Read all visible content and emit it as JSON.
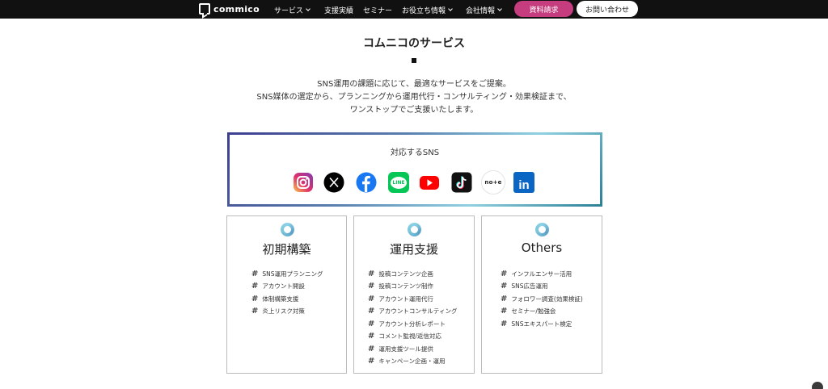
{
  "header": {
    "logo_text": "commico",
    "nav": [
      {
        "label": "サービス",
        "dropdown": true
      },
      {
        "label": "支援実績",
        "dropdown": false
      },
      {
        "label": "セミナー",
        "dropdown": false
      },
      {
        "label": "お役立ち情報",
        "dropdown": true
      },
      {
        "label": "会社情報",
        "dropdown": true
      }
    ],
    "request_button": "資料請求",
    "contact_button": "お問い合わせ"
  },
  "section": {
    "title": "コムニコのサービス",
    "description": [
      "SNS運用の課題に応じて、最適なサービスをご提案。",
      "SNS媒体の選定から、プランニングから運用代行・コンサルティング・効果検証まで、",
      "ワンストップでご支援いたします。"
    ]
  },
  "sns": {
    "title": "対応するSNS",
    "icons": [
      "instagram-icon",
      "x-icon",
      "facebook-icon",
      "line-icon",
      "youtube-icon",
      "tiktok-icon",
      "note-icon",
      "linkedin-icon"
    ],
    "line_text": "LINE",
    "note_text": "no+e",
    "linkedin_text": "in"
  },
  "services": [
    {
      "title": "初期構築",
      "items": [
        "SNS運用プランニング",
        "アカウント開設",
        "体制構築支援",
        "炎上リスク対策"
      ]
    },
    {
      "title": "運用支援",
      "items": [
        "投稿コンテンツ企画",
        "投稿コンテンツ制作",
        "アカウント運用代行",
        "アカウントコンサルティング",
        "アカウント分析レポート",
        "コメント監視/返信対応",
        "運用支援ツール提供",
        "キャンペーン企画・運用"
      ]
    },
    {
      "title": "Others",
      "items": [
        "インフルエンサー活用",
        "SNS広告運用",
        "フォロワー調査(効果検証)",
        "セミナー/勉強会",
        "SNSエキスパート検定"
      ]
    }
  ],
  "colors": {
    "header_bg": "#111111",
    "request_button_bg": "#c53d7e",
    "accent_ring": "#7ac3d9"
  }
}
